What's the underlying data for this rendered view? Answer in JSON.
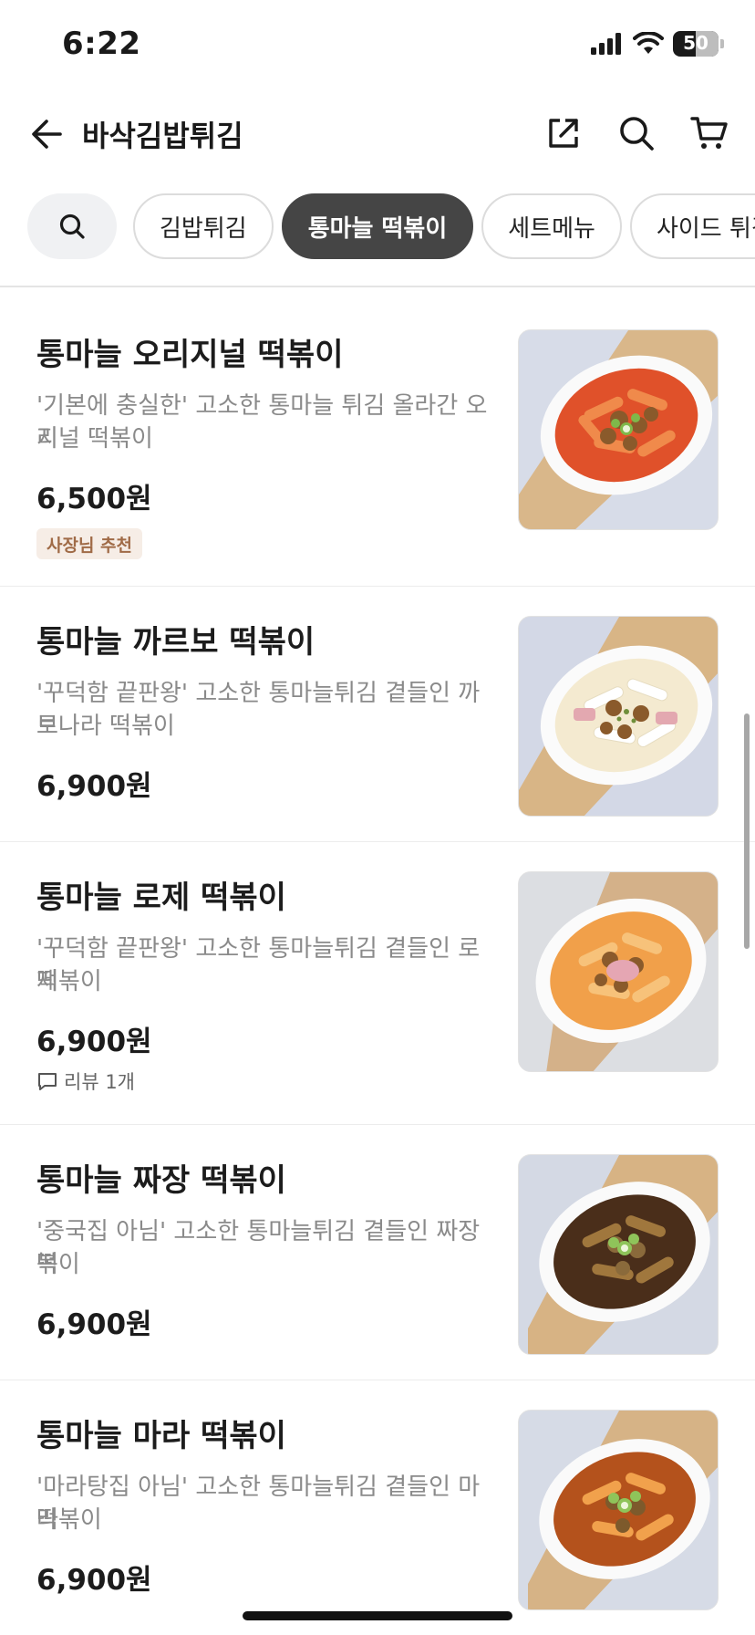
{
  "status_bar": {
    "time": "6:22",
    "battery": "50",
    "battery_level": 0.5
  },
  "header": {
    "title": "바삭김밥튀김",
    "icons": [
      "back-arrow-icon",
      "share-icon",
      "search-icon",
      "cart-icon"
    ]
  },
  "categories": {
    "search_icon": "search-icon",
    "items": [
      {
        "label": "김밥튀김",
        "active": false
      },
      {
        "label": "통마늘 떡볶이",
        "active": true
      },
      {
        "label": "세트메뉴",
        "active": false
      },
      {
        "label": "사이드 튀김",
        "active": false
      }
    ]
  },
  "menu": {
    "items": [
      {
        "name": "통마늘 오리지널 떡볶이",
        "desc_line1": "'기본에 충실한' 고소한 통마늘 튀김 올라간 오리",
        "desc_line2": "지널 떡볶이",
        "price": "6,500원",
        "badge": "사장님 추천"
      },
      {
        "name": "통마늘 까르보 떡볶이",
        "desc_line1": "'꾸덕함 끝판왕' 고소한 통마늘튀김 곁들인 까르",
        "desc_line2": "보나라 떡볶이",
        "price": "6,900원"
      },
      {
        "name": "통마늘 로제 떡볶이",
        "desc_line1": "'꾸덕함 끝판왕' 고소한 통마늘튀김 곁들인 로제",
        "desc_line2": "떡볶이",
        "price": "6,900원",
        "review": "리뷰 1개"
      },
      {
        "name": "통마늘 짜장 떡볶이",
        "desc_line1": "'중국집 아님' 고소한 통마늘튀김 곁들인 짜장 떡",
        "desc_line2": "볶이",
        "price": "6,900원"
      },
      {
        "name": "통마늘 마라 떡볶이",
        "desc_line1": "'마라탕집 아님' 고소한 통마늘튀김 곁들인 마라",
        "desc_line2": "떡볶이",
        "price": "6,900원"
      }
    ]
  },
  "colors": {
    "active_chip": "#454545",
    "badge_bg": "#f6ede6",
    "badge_text": "#a06b47",
    "desc_text": "#8a8a8a"
  }
}
